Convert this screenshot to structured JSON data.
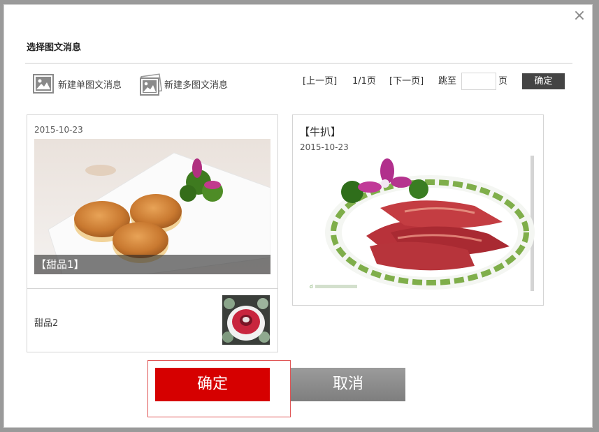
{
  "dialog": {
    "title": "选择图文消息",
    "close_glyph": "×"
  },
  "toolbar": {
    "new_single_label": "新建单图文消息",
    "new_multi_label": "新建多图文消息"
  },
  "pager": {
    "prev_label": "[上一页]",
    "page_info": "1/1页",
    "next_label": "[下一页]",
    "jump_label": "跳至",
    "input_value": "",
    "unit_label": "页",
    "go_label": "确定"
  },
  "items": [
    {
      "date": "2015-10-23",
      "cover_caption": "【甜品1】",
      "sub_title": "甜品2"
    },
    {
      "title": "【牛扒】",
      "date": "2015-10-23"
    }
  ],
  "actions": {
    "confirm_label": "确定",
    "cancel_label": "取消"
  },
  "colors": {
    "confirm": "#d60000",
    "cancel": "#8a8a8a",
    "go_button": "#444444"
  }
}
